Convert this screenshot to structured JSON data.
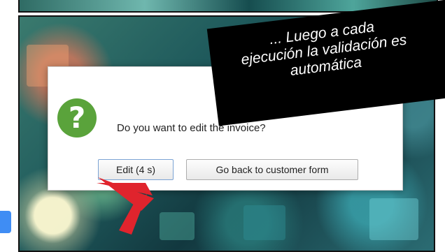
{
  "callout": {
    "line1": "... Luego a cada",
    "line2": "ejecución la validación es",
    "line3": "automática"
  },
  "dialog": {
    "message": "Do you want to edit the invoice?",
    "icon": "question-icon",
    "buttons": {
      "edit_label": "Edit (4 s)",
      "back_label": "Go back to customer form"
    }
  },
  "colors": {
    "icon_green": "#5aa33b",
    "arrow_red": "#e0242d",
    "callout_bg": "#000000",
    "side_tab": "#3f8df4"
  }
}
